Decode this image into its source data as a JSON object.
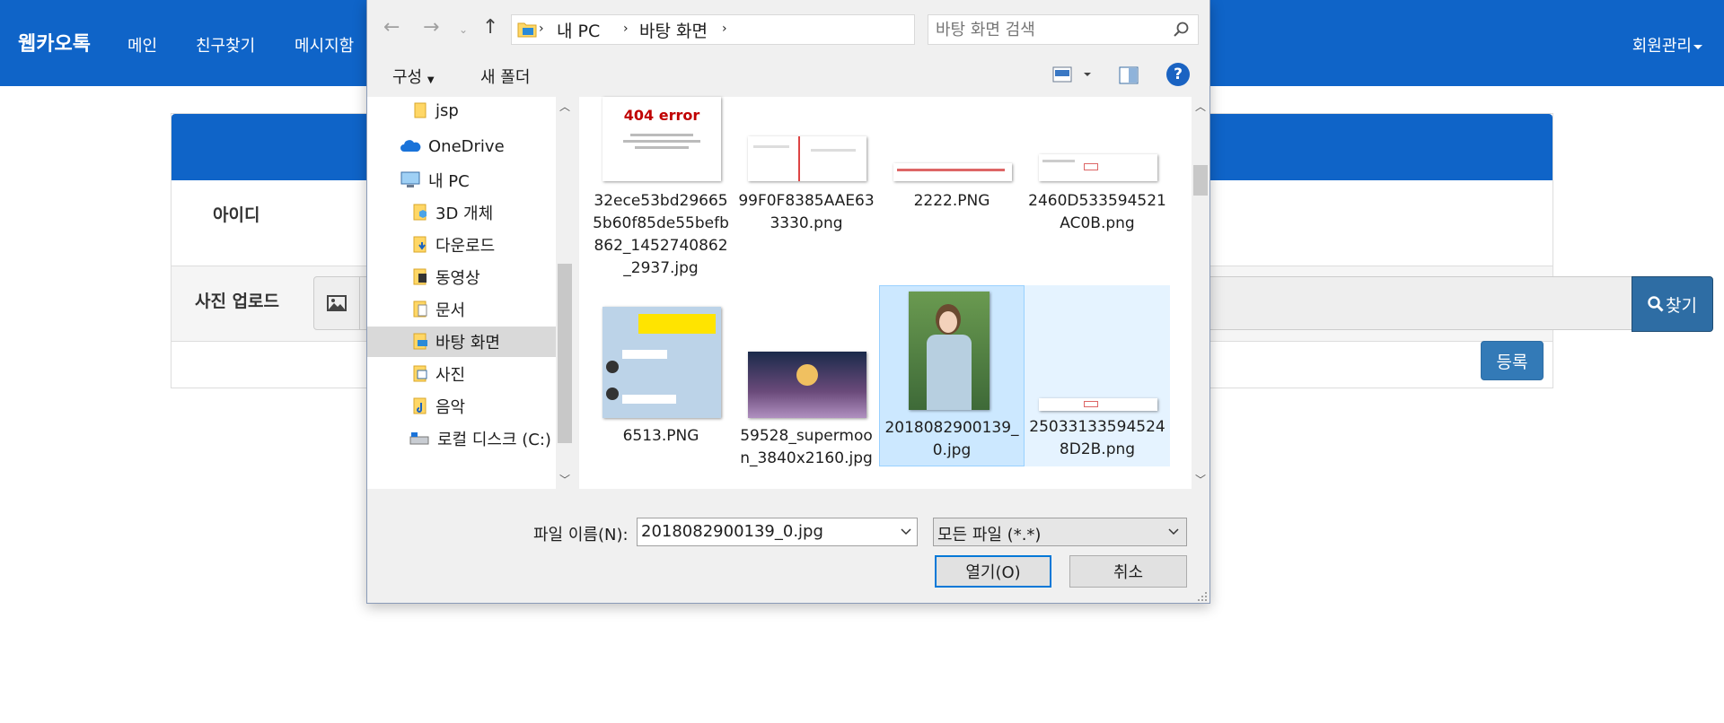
{
  "webpage": {
    "brand": "웹카오톡",
    "nav": [
      "메인",
      "친구찾기",
      "메시지함"
    ],
    "user_menu": "회원관리",
    "form": {
      "id_label": "아이디",
      "photo_label": "사진 업로드",
      "find_button": "찾기",
      "register_button": "등록"
    },
    "colors": {
      "navbar": "#0f64c8",
      "button": "#2e6da4"
    }
  },
  "dialog": {
    "breadcrumb": [
      "내 PC",
      "바탕 화면"
    ],
    "search_placeholder": "바탕 화면 검색",
    "toolbar": {
      "organize": "구성",
      "new_folder": "새 폴더",
      "help": "?"
    },
    "nav_items": [
      {
        "label": "jsp",
        "icon": "folder-icon"
      },
      {
        "label": "OneDrive",
        "icon": "onedrive-icon"
      },
      {
        "label": "내 PC",
        "icon": "pc-icon"
      },
      {
        "label": "3D 개체",
        "icon": "folder-3d-icon"
      },
      {
        "label": "다운로드",
        "icon": "downloads-icon"
      },
      {
        "label": "동영상",
        "icon": "videos-icon"
      },
      {
        "label": "문서",
        "icon": "documents-icon"
      },
      {
        "label": "바탕 화면",
        "icon": "desktop-folder-icon",
        "selected": true
      },
      {
        "label": "사진",
        "icon": "pictures-icon"
      },
      {
        "label": "음악",
        "icon": "music-icon"
      },
      {
        "label": "로컬 디스크 (C:)",
        "icon": "disk-icon"
      }
    ],
    "files": [
      {
        "name": "32ece53bd296655b60f85de55befb862_1452740862_2937.jpg",
        "thumb_text": "404 error"
      },
      {
        "name": "99F0F8385AAE633330.png"
      },
      {
        "name": "2222.PNG"
      },
      {
        "name": "2460D533594521AC0B.png"
      },
      {
        "name": "6513.PNG"
      },
      {
        "name": "59528_supermoon_3840x2160.jpg"
      },
      {
        "name": "2018082900139_0.jpg",
        "selected": true
      },
      {
        "name": "250331335945248D2B.png"
      }
    ],
    "file_name_label": "파일 이름(N):",
    "file_name_value": "2018082900139_0.jpg",
    "filter_value": "모든 파일 (*.*)",
    "open_button": "열기(O)",
    "cancel_button": "취소"
  }
}
